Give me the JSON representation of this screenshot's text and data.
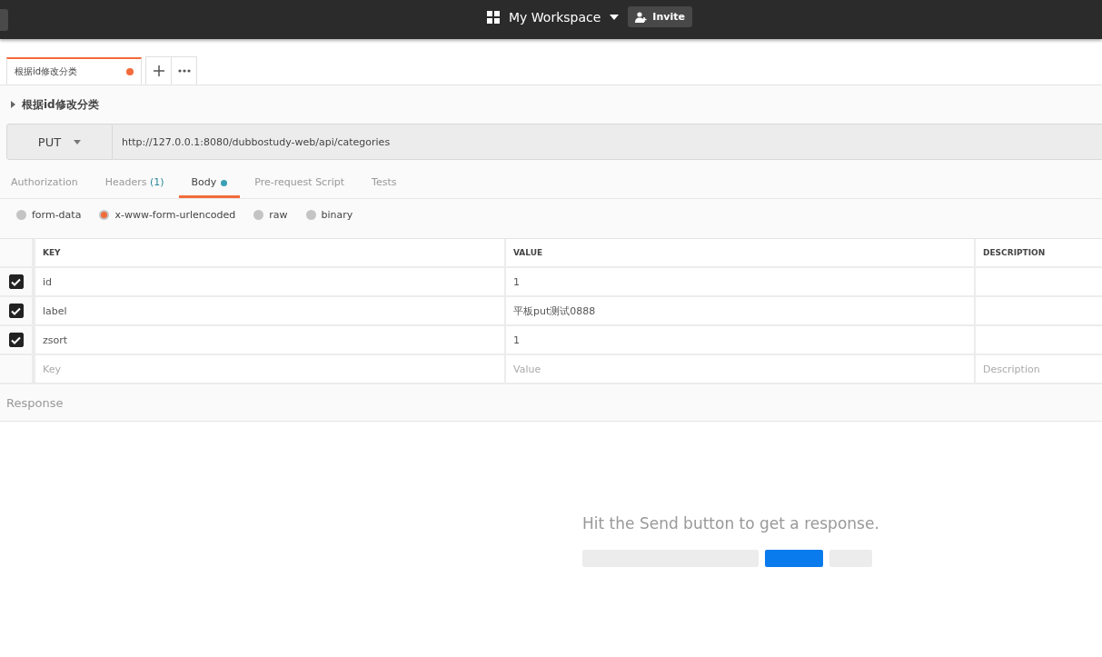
{
  "header": {
    "workspace": "My Workspace",
    "invite": "Invite"
  },
  "request_tabs": [
    {
      "label": "根据id修改分类",
      "selected": true,
      "unsaved": true
    }
  ],
  "request_title": "根据id修改分类",
  "request": {
    "method": "PUT",
    "url": "http://127.0.0.1:8080/dubbostudy-web/api/categories"
  },
  "section_tabs": [
    {
      "label": "Authorization",
      "selected": false
    },
    {
      "label": "Headers",
      "count": "(1)",
      "selected": false
    },
    {
      "label": "Body",
      "selected": true,
      "dot": true
    },
    {
      "label": "Pre-request Script",
      "selected": false
    },
    {
      "label": "Tests",
      "selected": false
    }
  ],
  "body_types": [
    {
      "label": "form-data",
      "selected": false
    },
    {
      "label": "x-www-form-urlencoded",
      "selected": true
    },
    {
      "label": "raw",
      "selected": false
    },
    {
      "label": "binary",
      "selected": false
    }
  ],
  "table": {
    "columns": [
      "KEY",
      "VALUE",
      "DESCRIPTION"
    ],
    "rows": [
      {
        "key": "id",
        "value": "1",
        "checked": true
      },
      {
        "key": "label",
        "value": "平板put测试0888",
        "checked": true
      },
      {
        "key": "zsort",
        "value": "1",
        "checked": true
      }
    ],
    "new_row": [
      {
        "placeholder": "Key"
      },
      {
        "placeholder": "Value"
      },
      {
        "placeholder": "Description"
      }
    ]
  },
  "response": {
    "title": "Response",
    "empty_message": "Hit the Send button to get a response."
  }
}
